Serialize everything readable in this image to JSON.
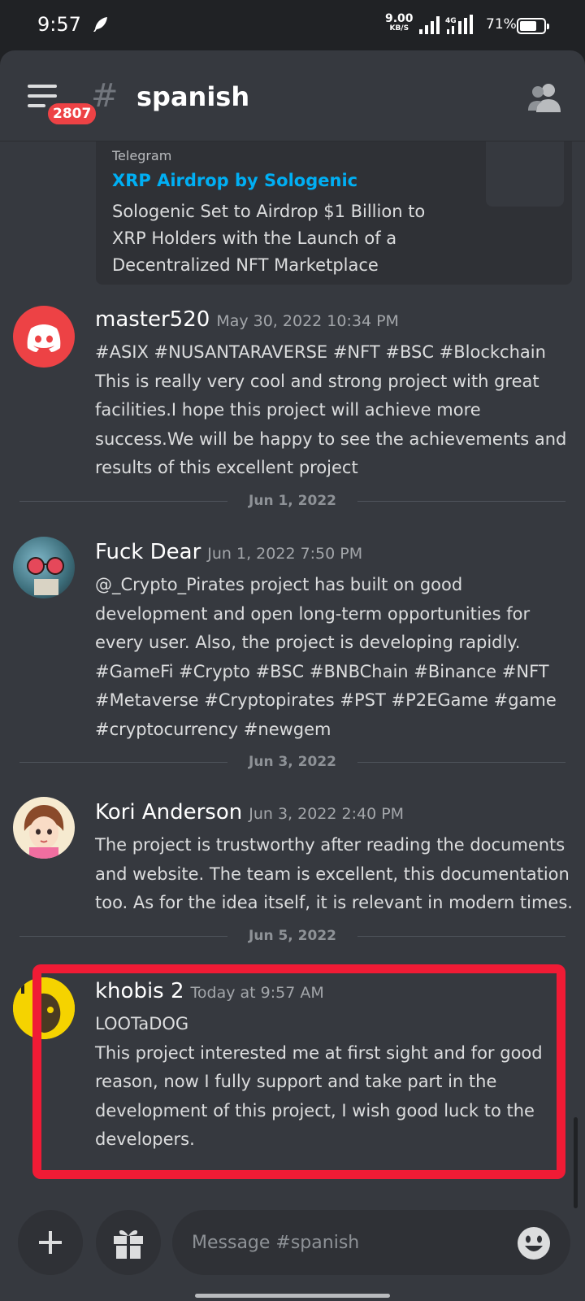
{
  "status_bar": {
    "time": "9:57",
    "net_speed": "9.00",
    "net_speed_unit": "KB/S",
    "battery": "71%"
  },
  "header": {
    "unread_badge": "2807",
    "channel_name": "spanish"
  },
  "embed": {
    "provider": "Telegram",
    "title": "XRP Airdrop by Sologenic",
    "description": "Sologenic Set to Airdrop $1 Billion to XRP Holders with the Launch of a Decentralized NFT Marketplace"
  },
  "messages": [
    {
      "author": "master520",
      "timestamp": "May 30, 2022 10:34 PM",
      "text": "#ASIX #NUSANTARAVERSE #NFT #BSC #Blockchain This is really very cool and strong project with great facilities.I hope this project will achieve more success.We will be happy to see the achievements and results of this excellent project"
    },
    {
      "author": "Fuck Dear",
      "timestamp": "Jun 1, 2022 7:50 PM",
      "text": "@_Crypto_Pirates  project has built on good development and open long-term opportunities for every user. Also, the project is developing rapidly. #GameFi #Crypto #BSC #BNBChain #Binance   #NFT #Metaverse #Cryptopirates #PST #P2EGame #game #cryptocurrency #newgem"
    },
    {
      "author": "Kori Anderson",
      "timestamp": "Jun 3, 2022 2:40 PM",
      "text": "The project is trustworthy after reading the documents and website. The team is excellent, this documentation too. As for the idea itself, it is relevant in modern times."
    },
    {
      "author": "khobis 2",
      "timestamp": "Today at 9:57 AM",
      "line1": "LOOTaDOG",
      "text": "This project interested me at first sight and for good reason, now I fully support and take part in the development of this project, I wish good luck to the developers."
    }
  ],
  "dividers": [
    "Jun 1, 2022",
    "Jun 3, 2022",
    "Jun 5, 2022"
  ],
  "composer": {
    "placeholder": "Message #spanish"
  },
  "colors": {
    "background": "#36393f",
    "highlight": "#f01b35",
    "link": "#00aff4",
    "discord_red": "#ed4245"
  }
}
